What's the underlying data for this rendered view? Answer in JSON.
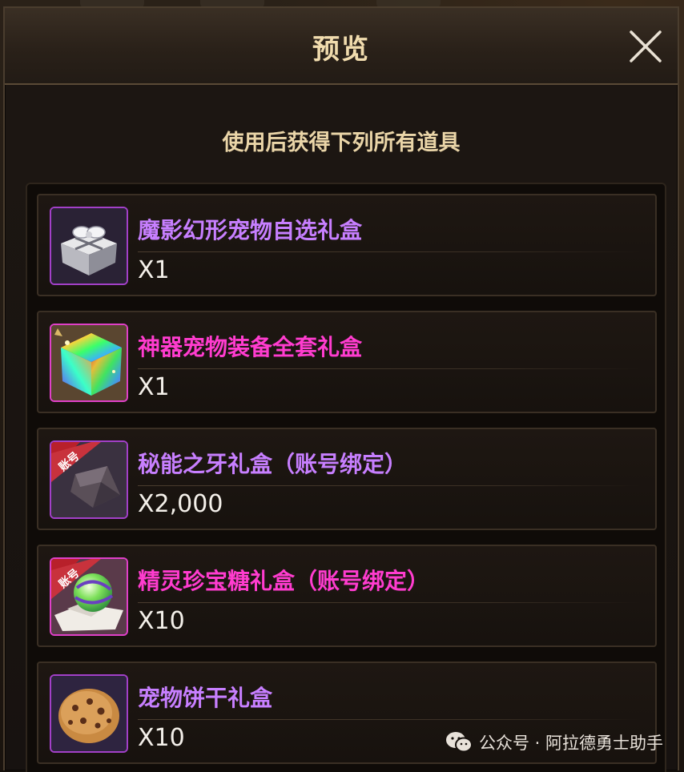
{
  "dialog": {
    "title": "预览",
    "close_icon": "close-icon",
    "subtitle": "使用后获得下列所有道具"
  },
  "items": [
    {
      "name": "魔影幻形宠物自选礼盒",
      "quantity": "X1",
      "name_color": "#c77fff",
      "icon": "silver-gift-box-icon"
    },
    {
      "name": "神器宠物装备全套礼盒",
      "quantity": "X1",
      "name_color": "#ff3ccf",
      "icon": "rainbow-gift-box-icon"
    },
    {
      "name": "秘能之牙礼盒（账号绑定）",
      "quantity": "X2,000",
      "name_color": "#c77fff",
      "icon": "fang-stone-icon",
      "badge": "账号"
    },
    {
      "name": "精灵珍宝糖礼盒（账号绑定）",
      "quantity": "X10",
      "name_color": "#ff3ccf",
      "icon": "candy-ball-icon",
      "badge": "账号"
    },
    {
      "name": "宠物饼干礼盒",
      "quantity": "X10",
      "name_color": "#c77fff",
      "icon": "cookie-icon"
    }
  ],
  "watermark": {
    "text": "公众号 · 阿拉德勇士助手",
    "icon": "wechat-icon"
  }
}
